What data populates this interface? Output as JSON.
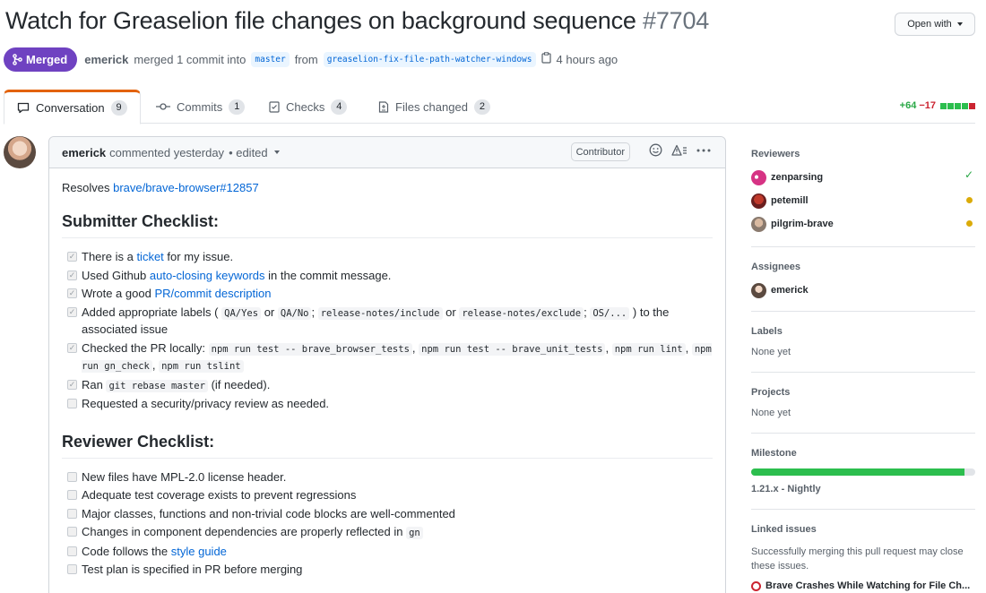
{
  "header": {
    "title": "Watch for Greaselion file changes on background sequence",
    "number": "#7704",
    "open_with": "Open with"
  },
  "meta": {
    "status": "Merged",
    "author": "emerick",
    "merged_text": "merged 1 commit into",
    "base_branch": "master",
    "from_text": "from",
    "head_branch": "greaselion-fix-file-path-watcher-windows",
    "time": "4 hours ago"
  },
  "tabs": [
    {
      "label": "Conversation",
      "count": "9"
    },
    {
      "label": "Commits",
      "count": "1"
    },
    {
      "label": "Checks",
      "count": "4"
    },
    {
      "label": "Files changed",
      "count": "2"
    }
  ],
  "diffstat": {
    "additions": "+64",
    "deletions": "−17"
  },
  "comment": {
    "author": "emerick",
    "text": "commented yesterday",
    "edited": "• edited",
    "role": "Contributor",
    "resolves_text": "Resolves",
    "resolves_link": "brave/brave-browser#12857"
  },
  "submitter": {
    "heading": "Submitter Checklist:",
    "i1_a": "There is a",
    "i1_link": "ticket",
    "i1_b": "for my issue.",
    "i2_a": "Used Github",
    "i2_link": "auto-closing keywords",
    "i2_b": "in the commit message.",
    "i3_a": "Wrote a good",
    "i3_link": "PR/commit description",
    "i4_a": "Added appropriate labels (",
    "i4_c1": "QA/Yes",
    "i4_or1": "or",
    "i4_c2": "QA/No",
    "i4_sep1": ";",
    "i4_c3": "release-notes/include",
    "i4_or2": "or",
    "i4_c4": "release-notes/exclude",
    "i4_sep2": ";",
    "i4_c5": "OS/...",
    "i4_b": ") to the associated issue",
    "i5_a": "Checked the PR locally:",
    "i5_c1": "npm run test -- brave_browser_tests",
    "i5_s1": ",",
    "i5_c2": "npm run test -- brave_unit_tests",
    "i5_s2": ",",
    "i5_c3": "npm run lint",
    "i5_s3": ",",
    "i5_c4": "npm run gn_check",
    "i5_s4": ",",
    "i5_c5": "npm run tslint",
    "i6_a": "Ran",
    "i6_c": "git rebase master",
    "i6_b": "(if needed).",
    "i7": "Requested a security/privacy review as needed."
  },
  "reviewer_checklist": {
    "heading": "Reviewer Checklist:",
    "r1": "New files have MPL-2.0 license header.",
    "r2": "Adequate test coverage exists to prevent regressions",
    "r3": "Major classes, functions and non-trivial code blocks are well-commented",
    "r4_a": "Changes in component dependencies are properly reflected in",
    "r4_c": "gn",
    "r5_a": "Code follows the",
    "r5_link": "style guide",
    "r6": "Test plan is specified in PR before merging"
  },
  "sidebar": {
    "reviewers_heading": "Reviewers",
    "reviewers": [
      {
        "name": "zenparsing",
        "status": "approved"
      },
      {
        "name": "petemill",
        "status": "pending"
      },
      {
        "name": "pilgrim-brave",
        "status": "pending"
      }
    ],
    "assignees_heading": "Assignees",
    "assignee": "emerick",
    "labels_heading": "Labels",
    "labels_value": "None yet",
    "projects_heading": "Projects",
    "projects_value": "None yet",
    "milestone_heading": "Milestone",
    "milestone_name": "1.21.x - Nightly",
    "milestone_progress": 0.95,
    "linked_heading": "Linked issues",
    "linked_desc": "Successfully merging this pull request may close these issues.",
    "linked_issue": "Brave Crashes While Watching for File Ch..."
  },
  "colors": {
    "merged": "#6f42c1",
    "link": "#0366d6",
    "approved": "#28a745",
    "pending": "#dbab09",
    "tab_accent": "#e36209"
  }
}
